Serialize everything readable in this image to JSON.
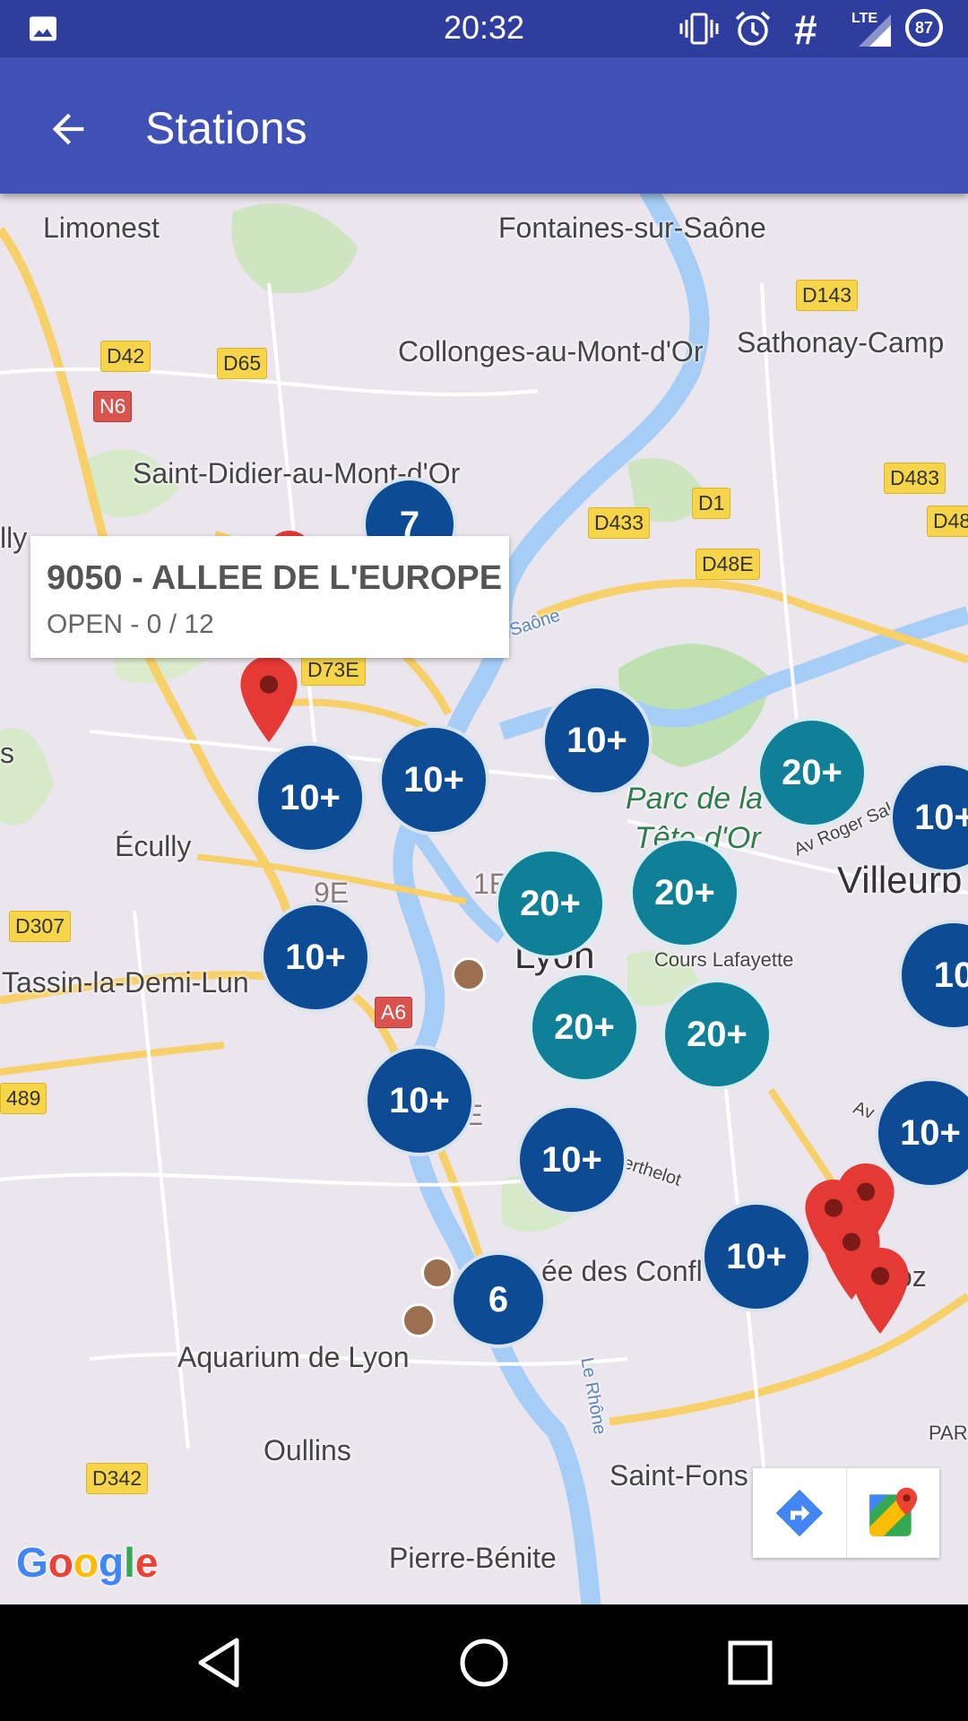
{
  "status_bar": {
    "time": "20:32",
    "network": "LTE",
    "battery": "87",
    "icons": [
      "image-icon",
      "vibrate-icon",
      "alarm-icon",
      "hash-icon",
      "signal-icon",
      "battery-icon"
    ]
  },
  "app_bar": {
    "title": "Stations",
    "back_icon": "arrow-back-icon",
    "color": "#3f51b5"
  },
  "info_window": {
    "title": "9050 - ALLEE DE L'EUROPE",
    "subtitle": "OPEN - 0 / 12"
  },
  "map": {
    "places": {
      "limonest": "Limonest",
      "fontaines": "Fontaines-sur-Saône",
      "collonges": "Collonges-au-Mont-d'Or",
      "sathonay": "Sathonay-Camp",
      "saint_didier": "Saint-Didier-au-Mont-d'Or",
      "lly": "lly",
      "s": "s",
      "ecully": "Écully",
      "tassin": "Tassin-la-Demi-Lun",
      "lyon": "Lyon",
      "parc1": "Parc de la",
      "parc2": "Tête d'Or",
      "villeurb": "Villeurb",
      "cours_lafayette": "Cours Lafayette",
      "saone": "Saône",
      "av_roger": "Av Roger Salengro",
      "confl": "ée des Confl",
      "aquarium": "Aquarium de Lyon",
      "oullins": "Oullins",
      "saint_fons": "Saint-Fons",
      "pierre_benite": "Pierre-Bénite",
      "le_rhone": "Le Rhône",
      "erthelot": "erthelot",
      "par": "PAR",
      "oz": "oz",
      "av": "Av",
      "nine_e": "9E",
      "one_e": "1E",
      "two_e": "2E"
    },
    "roads": {
      "d42": "D42",
      "d65": "D65",
      "n6": "N6",
      "d143": "D143",
      "d483": "D483",
      "d48": "D48",
      "d1": "D1",
      "d433": "D433",
      "d48e": "D48E",
      "d73e": "D73E",
      "d307": "D307",
      "a6": "A6",
      "r489": "489",
      "d342": "D342"
    },
    "clusters": [
      {
        "label": "7",
        "color": "blue"
      },
      {
        "label": "10+",
        "color": "blue"
      },
      {
        "label": "20+",
        "color": "teal"
      },
      {
        "label": "10+",
        "color": "blue"
      },
      {
        "label": "10+",
        "color": "blue"
      },
      {
        "label": "10+",
        "color": "blue"
      },
      {
        "label": "20+",
        "color": "teal"
      },
      {
        "label": "20+",
        "color": "teal"
      },
      {
        "label": "10",
        "color": "blue"
      },
      {
        "label": "10+",
        "color": "blue"
      },
      {
        "label": "20+",
        "color": "teal"
      },
      {
        "label": "20+",
        "color": "teal"
      },
      {
        "label": "10+",
        "color": "blue"
      },
      {
        "label": "10+",
        "color": "blue"
      },
      {
        "label": "10+",
        "color": "blue"
      },
      {
        "label": "10+",
        "color": "blue"
      },
      {
        "label": "6",
        "color": "blue"
      }
    ],
    "cluster_colors": {
      "blue": "#0d4b94",
      "teal": "#107f98"
    },
    "marker_color": "#e53935",
    "logo": "Google"
  },
  "map_toolbar": {
    "directions_icon": "directions-icon",
    "maps_icon": "google-maps-icon"
  },
  "nav_bar": {
    "icons": [
      "back-triangle-icon",
      "home-circle-icon",
      "recents-square-icon"
    ]
  }
}
